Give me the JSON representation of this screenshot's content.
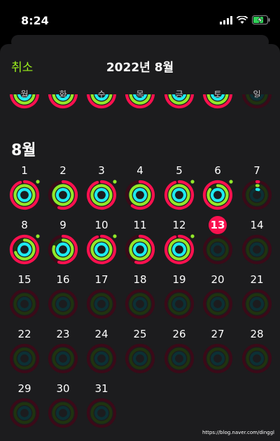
{
  "status_bar": {
    "time": "8:24"
  },
  "nav": {
    "cancel_label": "취소",
    "title": "2022년 8월"
  },
  "weekdays": [
    "월",
    "화",
    "수",
    "목",
    "금",
    "토",
    "일"
  ],
  "month_label": "8월",
  "today": 13,
  "days": [
    {
      "d": 1,
      "move": 0.95,
      "exercise": 1.0,
      "stand": 1.0,
      "done": true
    },
    {
      "d": 2,
      "move": 0.55,
      "exercise": 1.0,
      "stand": 1.0,
      "done": false
    },
    {
      "d": 3,
      "move": 0.95,
      "exercise": 1.0,
      "stand": 1.0,
      "done": true
    },
    {
      "d": 4,
      "move": 0.6,
      "exercise": 1.0,
      "stand": 1.0,
      "done": false
    },
    {
      "d": 5,
      "move": 0.95,
      "exercise": 1.0,
      "stand": 1.0,
      "done": true
    },
    {
      "d": 6,
      "move": 1.0,
      "exercise": 0.85,
      "stand": 1.0,
      "done": true
    },
    {
      "d": 7,
      "move": 0.02,
      "exercise": 0.02,
      "stand": 0.05,
      "done": false
    },
    {
      "d": 8,
      "move": 1.0,
      "exercise": 0.7,
      "stand": 1.0,
      "done": true
    },
    {
      "d": 9,
      "move": 0.55,
      "exercise": 0.8,
      "stand": 1.0,
      "done": false
    },
    {
      "d": 10,
      "move": 0.95,
      "exercise": 1.0,
      "stand": 1.0,
      "done": true
    },
    {
      "d": 11,
      "move": 0.55,
      "exercise": 1.0,
      "stand": 1.0,
      "done": false
    },
    {
      "d": 12,
      "move": 0.95,
      "exercise": 1.0,
      "stand": 1.0,
      "done": true
    },
    {
      "d": 13,
      "move": 0,
      "exercise": 0,
      "stand": 0,
      "done": false
    },
    {
      "d": 14,
      "move": 0,
      "exercise": 0,
      "stand": 0,
      "done": false
    },
    {
      "d": 15,
      "move": 0,
      "exercise": 0,
      "stand": 0,
      "done": false
    },
    {
      "d": 16,
      "move": 0,
      "exercise": 0,
      "stand": 0,
      "done": false
    },
    {
      "d": 17,
      "move": 0,
      "exercise": 0,
      "stand": 0,
      "done": false
    },
    {
      "d": 18,
      "move": 0,
      "exercise": 0,
      "stand": 0,
      "done": false
    },
    {
      "d": 19,
      "move": 0,
      "exercise": 0,
      "stand": 0,
      "done": false
    },
    {
      "d": 20,
      "move": 0,
      "exercise": 0,
      "stand": 0,
      "done": false
    },
    {
      "d": 21,
      "move": 0,
      "exercise": 0,
      "stand": 0,
      "done": false
    },
    {
      "d": 22,
      "move": 0,
      "exercise": 0,
      "stand": 0,
      "done": false
    },
    {
      "d": 23,
      "move": 0,
      "exercise": 0,
      "stand": 0,
      "done": false
    },
    {
      "d": 24,
      "move": 0,
      "exercise": 0,
      "stand": 0,
      "done": false
    },
    {
      "d": 25,
      "move": 0,
      "exercise": 0,
      "stand": 0,
      "done": false
    },
    {
      "d": 26,
      "move": 0,
      "exercise": 0,
      "stand": 0,
      "done": false
    },
    {
      "d": 27,
      "move": 0,
      "exercise": 0,
      "stand": 0,
      "done": false
    },
    {
      "d": 28,
      "move": 0,
      "exercise": 0,
      "stand": 0,
      "done": false
    },
    {
      "d": 29,
      "move": 0,
      "exercise": 0,
      "stand": 0,
      "done": false
    },
    {
      "d": 30,
      "move": 0,
      "exercise": 0,
      "stand": 0,
      "done": false
    },
    {
      "d": 31,
      "move": 0,
      "exercise": 0,
      "stand": 0,
      "done": false
    }
  ],
  "colors": {
    "move": "#fa114f",
    "exercise": "#92e82a",
    "stand": "#1eeaef",
    "move_track": "#3a0a18",
    "exercise_track": "#1f3310",
    "stand_track": "#0c3035",
    "accent": "#9cf01c",
    "today_badge": "#fa114f"
  },
  "watermark": "https://blog.naver.com/dinggl"
}
